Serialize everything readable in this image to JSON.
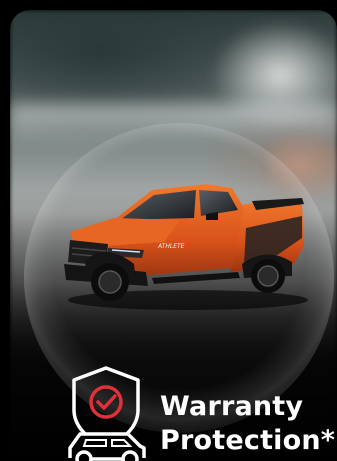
{
  "card": {
    "title_line1": "Warranty",
    "title_line2": "Protection*",
    "icon": "shield-check-car-icon",
    "vehicle_badge": "ATHLETE"
  },
  "colors": {
    "background": "#000000",
    "text": "#ffffff",
    "icon_outline": "#ffffff",
    "icon_check": "#e0303a",
    "truck_body": "#e35b1c"
  }
}
